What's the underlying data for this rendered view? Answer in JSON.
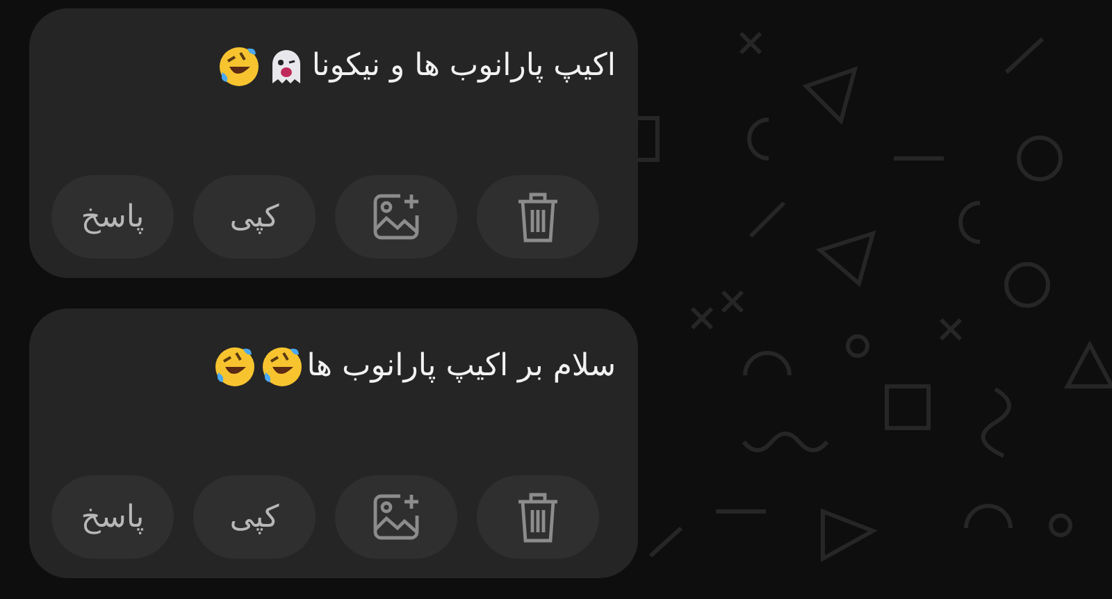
{
  "messages": [
    {
      "text": "اکیپ پارانوب ها و نیکونا",
      "emojis": [
        {
          "kind": "ghost"
        },
        {
          "kind": "rofl"
        }
      ],
      "actions": [
        {
          "kind": "delete"
        },
        {
          "kind": "save-image"
        },
        {
          "kind": "text",
          "label": "کپی"
        },
        {
          "kind": "text",
          "label": "پاسخ"
        }
      ]
    },
    {
      "text": "سلام بر اکیپ پارانوب ها",
      "emojis": [
        {
          "kind": "rofl"
        },
        {
          "kind": "rofl"
        }
      ],
      "actions": [
        {
          "kind": "delete"
        },
        {
          "kind": "save-image"
        },
        {
          "kind": "text",
          "label": "کپی"
        },
        {
          "kind": "text",
          "label": "پاسخ"
        }
      ]
    }
  ]
}
